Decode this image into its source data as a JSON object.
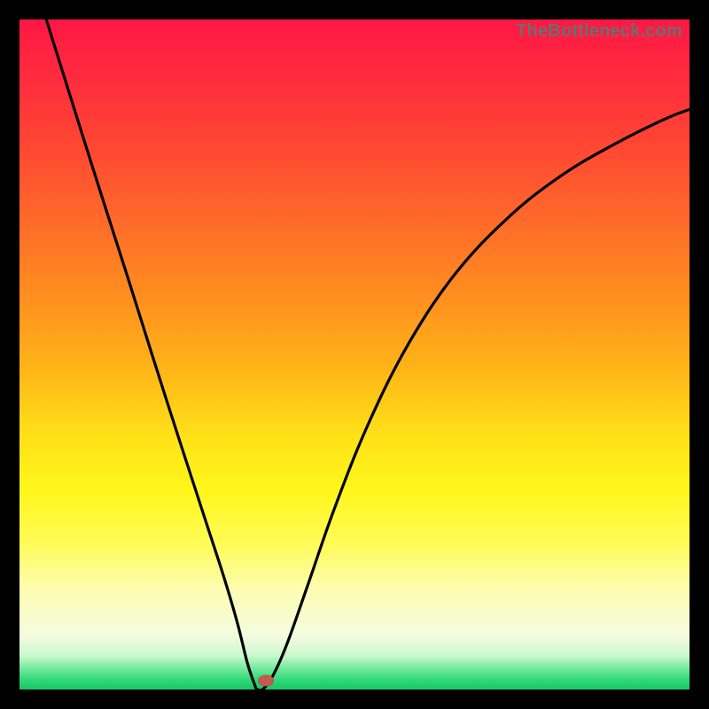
{
  "watermark": "TheBottleneck.com",
  "chart_data": {
    "type": "line",
    "title": "",
    "xlabel": "",
    "ylabel": "",
    "xlim": [
      0,
      1
    ],
    "ylim": [
      0,
      1
    ],
    "x_min_at": 0.355,
    "curve_points": [
      {
        "x": 0.04,
        "y": 1.0
      },
      {
        "x": 0.08,
        "y": 0.872
      },
      {
        "x": 0.12,
        "y": 0.745
      },
      {
        "x": 0.16,
        "y": 0.62
      },
      {
        "x": 0.2,
        "y": 0.493
      },
      {
        "x": 0.24,
        "y": 0.368
      },
      {
        "x": 0.28,
        "y": 0.245
      },
      {
        "x": 0.305,
        "y": 0.168
      },
      {
        "x": 0.325,
        "y": 0.1
      },
      {
        "x": 0.34,
        "y": 0.04
      },
      {
        "x": 0.35,
        "y": 0.01
      },
      {
        "x": 0.355,
        "y": 0.0
      },
      {
        "x": 0.365,
        "y": 0.002
      },
      {
        "x": 0.38,
        "y": 0.024
      },
      {
        "x": 0.4,
        "y": 0.07
      },
      {
        "x": 0.43,
        "y": 0.155
      },
      {
        "x": 0.47,
        "y": 0.27
      },
      {
        "x": 0.52,
        "y": 0.395
      },
      {
        "x": 0.58,
        "y": 0.515
      },
      {
        "x": 0.65,
        "y": 0.62
      },
      {
        "x": 0.73,
        "y": 0.705
      },
      {
        "x": 0.81,
        "y": 0.768
      },
      {
        "x": 0.89,
        "y": 0.815
      },
      {
        "x": 0.96,
        "y": 0.85
      },
      {
        "x": 1.0,
        "y": 0.866
      }
    ],
    "marker": {
      "x": 0.368,
      "y": 0.013,
      "color": "#c45a4f"
    },
    "colors": {
      "gradient_top": "#ff1744",
      "gradient_bottom": "#18c566",
      "frame": "#000000",
      "curve": "#000000"
    }
  }
}
